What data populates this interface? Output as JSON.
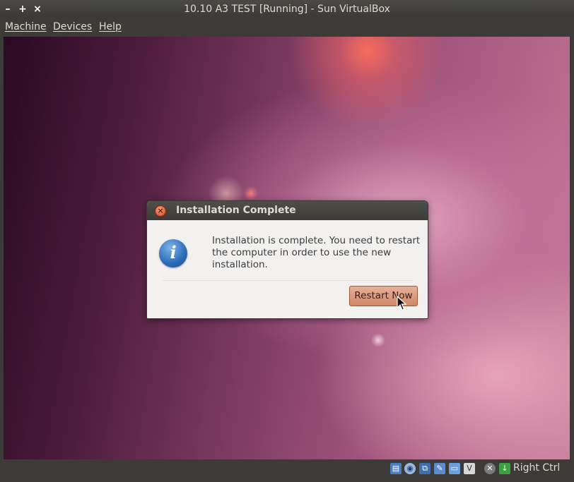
{
  "window": {
    "title": "10.10 A3 TEST [Running] - Sun VirtualBox",
    "minimize_glyph": "–",
    "maximize_glyph": "+",
    "close_glyph": "×"
  },
  "menubar": {
    "items": [
      {
        "label": "Machine"
      },
      {
        "label": "Devices"
      },
      {
        "label": "Help"
      }
    ]
  },
  "dialog": {
    "title": "Installation Complete",
    "message": "Installation is complete. You need to restart the computer in order to use the new installation.",
    "button_label": "Restart Now",
    "icon": "info-icon",
    "close_glyph": "×"
  },
  "statusbar": {
    "icons": [
      "hard-disk-icon",
      "optical-drive-icon",
      "network-icon",
      "usb-icon",
      "shared-folders-icon",
      "virtualization-icon",
      "mouse-integration-icon",
      "host-key-icon"
    ],
    "host_key_label": "Right Ctrl"
  },
  "colors": {
    "chrome_dark": "#3c3b37",
    "chrome_text": "#dfdbd2",
    "dialog_bg": "#f2f1f0",
    "button_accent": "#d99274",
    "info_blue": "#2a6bb8"
  }
}
